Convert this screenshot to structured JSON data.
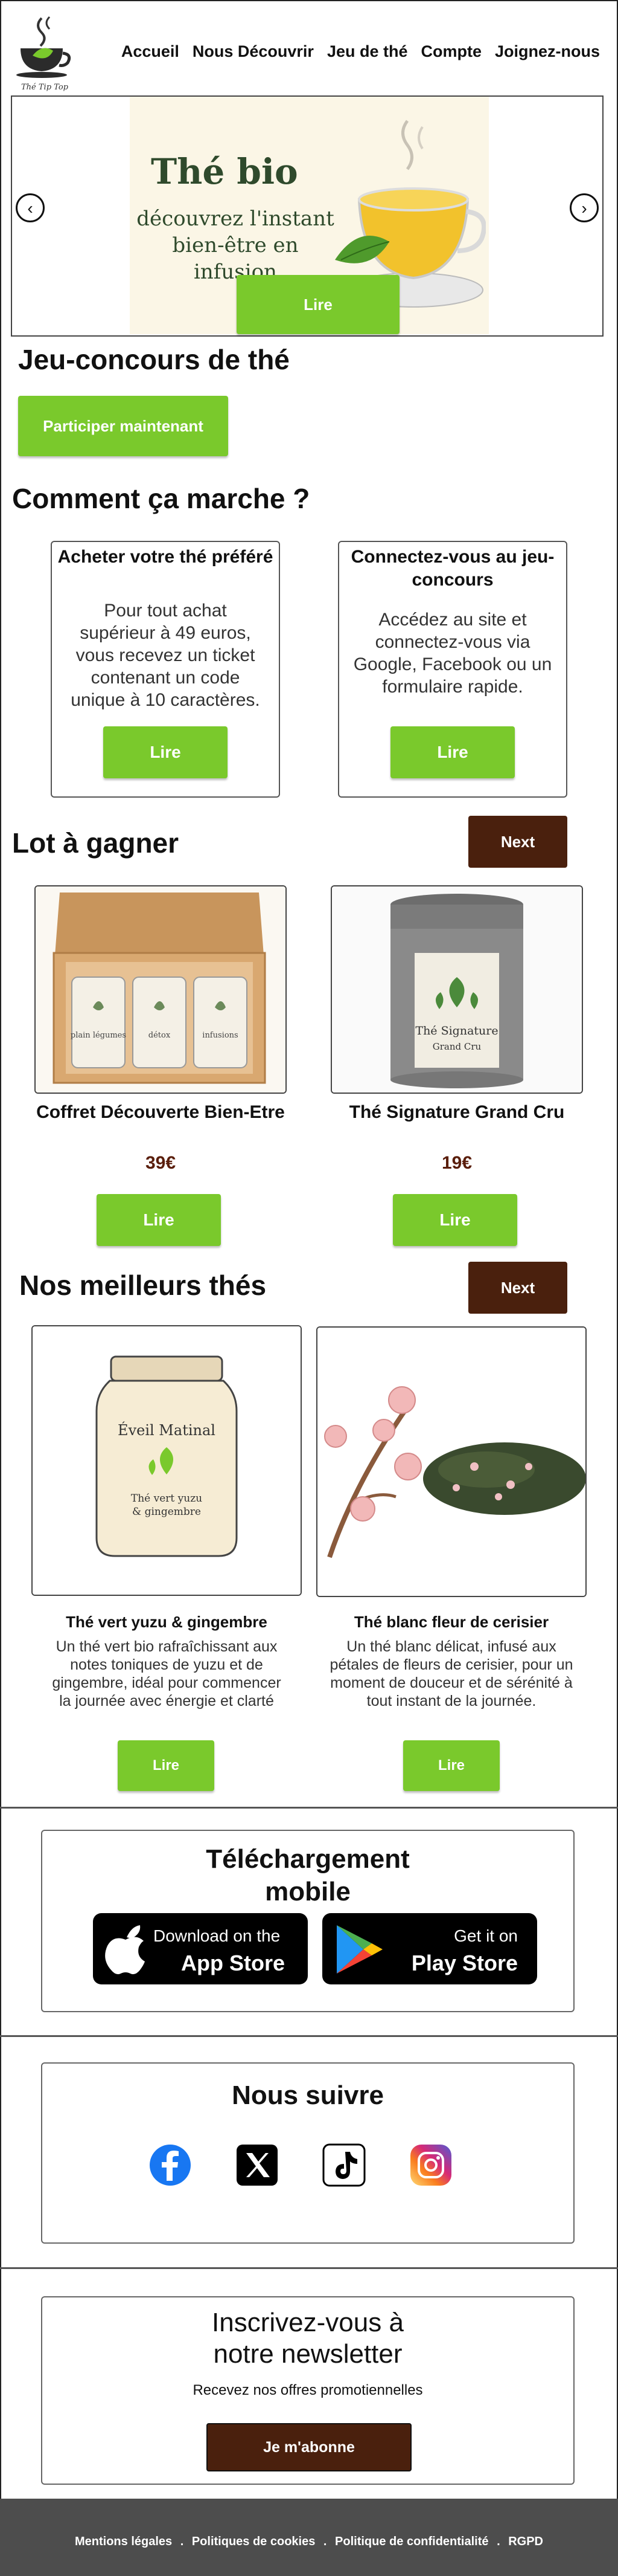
{
  "header": {
    "logo_text": "Thé Tip Top",
    "nav": [
      "Accueil",
      "Nous Découvrir",
      "Jeu de thé",
      "Compte",
      "Joignez-nous"
    ]
  },
  "carousel": {
    "title": "Thé bio",
    "subtitle_line1": "découvrez l'instant",
    "subtitle_line2": "bien-être en infusion",
    "button": "Lire",
    "prev_icon": "chevron-left-icon",
    "next_icon": "chevron-right-icon"
  },
  "contest": {
    "title": "Jeu-concours de thé",
    "button": "Participer maintenant"
  },
  "how": {
    "title": "Comment ça marche ?",
    "cards": [
      {
        "title": "Acheter votre thé préféré",
        "body": "Pour tout achat supérieur à 49 euros, vous recevez un ticket contenant un code unique à 10 caractères.",
        "button": "Lire"
      },
      {
        "title": "Connectez-vous au jeu-concours",
        "body": "Accédez au site et connectez-vous via Google, Facebook ou un formulaire rapide.",
        "button": "Lire"
      }
    ]
  },
  "prizes": {
    "title": "Lot à gagner",
    "next": "Next",
    "items": [
      {
        "name": "Coffret Découverte Bien-Etre",
        "price": "39€",
        "button": "Lire",
        "labels": [
          "plain légumes",
          "détox",
          "infusions"
        ]
      },
      {
        "name": "Thé Signature Grand Cru",
        "price": "19€",
        "button": "Lire",
        "label1": "Thé Signature",
        "label2": "Grand Cru"
      }
    ]
  },
  "best": {
    "title": "Nos meilleurs thés",
    "next": "Next",
    "items": [
      {
        "name": "Thé vert yuzu & gingembre",
        "desc": "Un thé vert bio rafraîchissant aux notes toniques de yuzu et de gingembre, idéal pour commencer la journée avec énergie et clarté",
        "button": "Lire",
        "jar_title": "Éveil Matinal",
        "jar_sub1": "Thé vert yuzu",
        "jar_sub2": "& gingembre"
      },
      {
        "name": "Thé blanc fleur de cerisier",
        "desc": "Un thé blanc délicat, infusé aux pétales de fleurs de cerisier, pour un moment de douceur et de sérénité à tout instant de la journée.",
        "button": "Lire"
      }
    ]
  },
  "download": {
    "title_line1": "Téléchargement",
    "title_line2": "mobile",
    "appstore_small": "Download on the",
    "appstore_big": "App Store",
    "play_small": "Get it on",
    "play_big": "Play Store"
  },
  "follow": {
    "title": "Nous suivre",
    "icons": [
      "facebook-icon",
      "x-icon",
      "tiktok-icon",
      "instagram-icon"
    ]
  },
  "newsletter": {
    "title_line1": "Inscrivez-vous à",
    "title_line2": "notre newsletter",
    "subtitle": "Recevez nos offres promotiennelles",
    "button": "Je m'abonne"
  },
  "footer": {
    "links": [
      "Mentions légales",
      "Politiques de cookies",
      "Politique de confidentialité",
      "RGPD"
    ],
    "separator": "."
  },
  "colors": {
    "green": "#7ac92c",
    "brown": "#4a200d",
    "footer": "#4d4d4d"
  }
}
